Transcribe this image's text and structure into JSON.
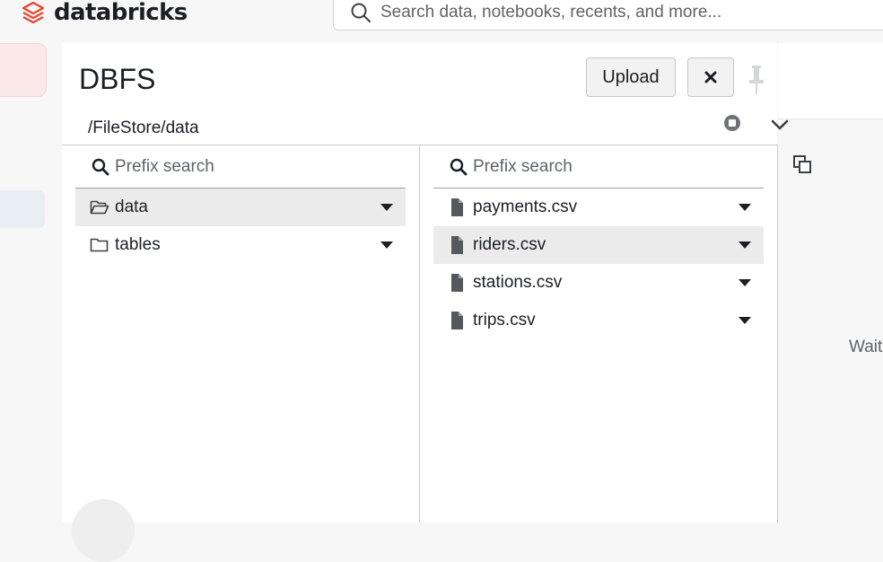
{
  "brand": {
    "name": "databricks",
    "color": "#e8442c"
  },
  "search": {
    "placeholder": "Search data, notebooks, recents, and more...",
    "icon": "search-icon"
  },
  "dialog": {
    "title": "DBFS",
    "upload_label": "Upload",
    "close_icon": "close-icon",
    "pin_icon": "pin-icon",
    "path": "/FileStore/data"
  },
  "folders_column": {
    "search_placeholder": "Prefix search",
    "items": [
      {
        "label": "data",
        "icon": "folder-open-icon",
        "selected": true
      },
      {
        "label": "tables",
        "icon": "folder-icon",
        "selected": false
      }
    ]
  },
  "files_column": {
    "search_placeholder": "Prefix search",
    "items": [
      {
        "label": "payments.csv",
        "icon": "file-icon",
        "selected": false
      },
      {
        "label": "riders.csv",
        "icon": "file-icon",
        "selected": true
      },
      {
        "label": "stations.csv",
        "icon": "file-icon",
        "selected": false
      },
      {
        "label": "trips.csv",
        "icon": "file-icon",
        "selected": false
      }
    ]
  },
  "preview": {
    "status_text": "Wait"
  }
}
